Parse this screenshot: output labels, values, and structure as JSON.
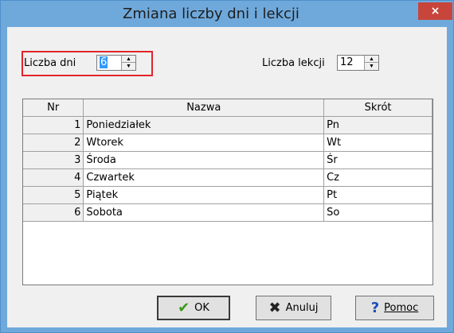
{
  "window": {
    "title": "Zmiana liczby dni i lekcji",
    "close_glyph": "×"
  },
  "liczba_dni": {
    "label": "Liczba dni",
    "value": "6"
  },
  "liczba_lekcji": {
    "label": "Liczba lekcji",
    "value": "12"
  },
  "table": {
    "headers": [
      "Nr",
      "Nazwa",
      "Skrót"
    ],
    "rows": [
      {
        "nr": "1",
        "nazwa": "Poniedziałek",
        "skrot": "Pn"
      },
      {
        "nr": "2",
        "nazwa": "Wtorek",
        "skrot": "Wt"
      },
      {
        "nr": "3",
        "nazwa": "Środa",
        "skrot": "Śr"
      },
      {
        "nr": "4",
        "nazwa": "Czwartek",
        "skrot": "Cz"
      },
      {
        "nr": "5",
        "nazwa": "Piątek",
        "skrot": "Pt"
      },
      {
        "nr": "6",
        "nazwa": "Sobota",
        "skrot": "So"
      }
    ]
  },
  "buttons": {
    "ok": {
      "label": "OK",
      "icon": "checkmark-icon"
    },
    "cancel": {
      "label": "Anuluj",
      "icon": "x-mark-icon"
    },
    "help": {
      "label": "Pomoc",
      "icon": "question-icon"
    }
  },
  "colors": {
    "title_bar": "#6fa9dc",
    "close": "#c7453b",
    "highlight_box": "#e2242a",
    "selection": "#3399ff",
    "ok_check": "#3c9a1a",
    "cancel_x": "#222222",
    "help_q": "#1c4fb8"
  }
}
